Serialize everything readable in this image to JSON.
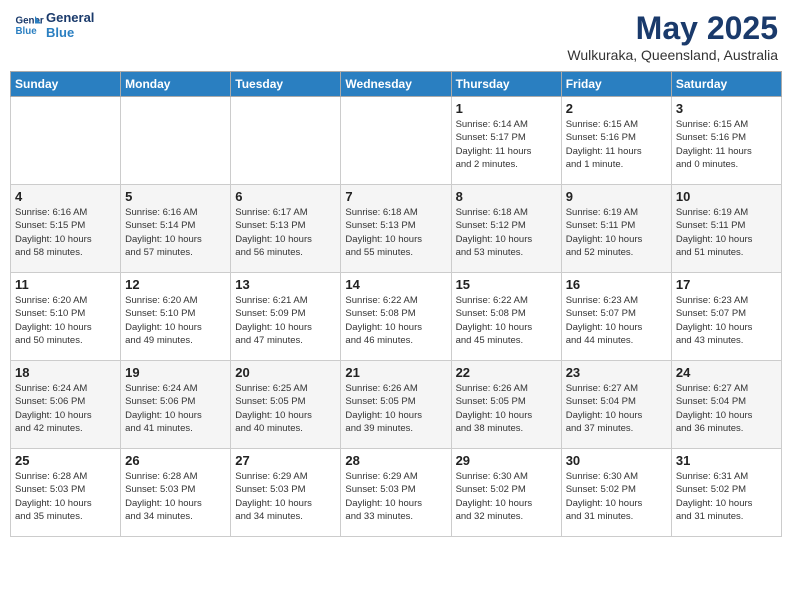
{
  "header": {
    "logo_line1": "General",
    "logo_line2": "Blue",
    "title": "May 2025",
    "subtitle": "Wulkuraka, Queensland, Australia"
  },
  "columns": [
    "Sunday",
    "Monday",
    "Tuesday",
    "Wednesday",
    "Thursday",
    "Friday",
    "Saturday"
  ],
  "weeks": [
    [
      {
        "day": "",
        "info": ""
      },
      {
        "day": "",
        "info": ""
      },
      {
        "day": "",
        "info": ""
      },
      {
        "day": "",
        "info": ""
      },
      {
        "day": "1",
        "info": "Sunrise: 6:14 AM\nSunset: 5:17 PM\nDaylight: 11 hours\nand 2 minutes."
      },
      {
        "day": "2",
        "info": "Sunrise: 6:15 AM\nSunset: 5:16 PM\nDaylight: 11 hours\nand 1 minute."
      },
      {
        "day": "3",
        "info": "Sunrise: 6:15 AM\nSunset: 5:16 PM\nDaylight: 11 hours\nand 0 minutes."
      }
    ],
    [
      {
        "day": "4",
        "info": "Sunrise: 6:16 AM\nSunset: 5:15 PM\nDaylight: 10 hours\nand 58 minutes."
      },
      {
        "day": "5",
        "info": "Sunrise: 6:16 AM\nSunset: 5:14 PM\nDaylight: 10 hours\nand 57 minutes."
      },
      {
        "day": "6",
        "info": "Sunrise: 6:17 AM\nSunset: 5:13 PM\nDaylight: 10 hours\nand 56 minutes."
      },
      {
        "day": "7",
        "info": "Sunrise: 6:18 AM\nSunset: 5:13 PM\nDaylight: 10 hours\nand 55 minutes."
      },
      {
        "day": "8",
        "info": "Sunrise: 6:18 AM\nSunset: 5:12 PM\nDaylight: 10 hours\nand 53 minutes."
      },
      {
        "day": "9",
        "info": "Sunrise: 6:19 AM\nSunset: 5:11 PM\nDaylight: 10 hours\nand 52 minutes."
      },
      {
        "day": "10",
        "info": "Sunrise: 6:19 AM\nSunset: 5:11 PM\nDaylight: 10 hours\nand 51 minutes."
      }
    ],
    [
      {
        "day": "11",
        "info": "Sunrise: 6:20 AM\nSunset: 5:10 PM\nDaylight: 10 hours\nand 50 minutes."
      },
      {
        "day": "12",
        "info": "Sunrise: 6:20 AM\nSunset: 5:10 PM\nDaylight: 10 hours\nand 49 minutes."
      },
      {
        "day": "13",
        "info": "Sunrise: 6:21 AM\nSunset: 5:09 PM\nDaylight: 10 hours\nand 47 minutes."
      },
      {
        "day": "14",
        "info": "Sunrise: 6:22 AM\nSunset: 5:08 PM\nDaylight: 10 hours\nand 46 minutes."
      },
      {
        "day": "15",
        "info": "Sunrise: 6:22 AM\nSunset: 5:08 PM\nDaylight: 10 hours\nand 45 minutes."
      },
      {
        "day": "16",
        "info": "Sunrise: 6:23 AM\nSunset: 5:07 PM\nDaylight: 10 hours\nand 44 minutes."
      },
      {
        "day": "17",
        "info": "Sunrise: 6:23 AM\nSunset: 5:07 PM\nDaylight: 10 hours\nand 43 minutes."
      }
    ],
    [
      {
        "day": "18",
        "info": "Sunrise: 6:24 AM\nSunset: 5:06 PM\nDaylight: 10 hours\nand 42 minutes."
      },
      {
        "day": "19",
        "info": "Sunrise: 6:24 AM\nSunset: 5:06 PM\nDaylight: 10 hours\nand 41 minutes."
      },
      {
        "day": "20",
        "info": "Sunrise: 6:25 AM\nSunset: 5:05 PM\nDaylight: 10 hours\nand 40 minutes."
      },
      {
        "day": "21",
        "info": "Sunrise: 6:26 AM\nSunset: 5:05 PM\nDaylight: 10 hours\nand 39 minutes."
      },
      {
        "day": "22",
        "info": "Sunrise: 6:26 AM\nSunset: 5:05 PM\nDaylight: 10 hours\nand 38 minutes."
      },
      {
        "day": "23",
        "info": "Sunrise: 6:27 AM\nSunset: 5:04 PM\nDaylight: 10 hours\nand 37 minutes."
      },
      {
        "day": "24",
        "info": "Sunrise: 6:27 AM\nSunset: 5:04 PM\nDaylight: 10 hours\nand 36 minutes."
      }
    ],
    [
      {
        "day": "25",
        "info": "Sunrise: 6:28 AM\nSunset: 5:03 PM\nDaylight: 10 hours\nand 35 minutes."
      },
      {
        "day": "26",
        "info": "Sunrise: 6:28 AM\nSunset: 5:03 PM\nDaylight: 10 hours\nand 34 minutes."
      },
      {
        "day": "27",
        "info": "Sunrise: 6:29 AM\nSunset: 5:03 PM\nDaylight: 10 hours\nand 34 minutes."
      },
      {
        "day": "28",
        "info": "Sunrise: 6:29 AM\nSunset: 5:03 PM\nDaylight: 10 hours\nand 33 minutes."
      },
      {
        "day": "29",
        "info": "Sunrise: 6:30 AM\nSunset: 5:02 PM\nDaylight: 10 hours\nand 32 minutes."
      },
      {
        "day": "30",
        "info": "Sunrise: 6:30 AM\nSunset: 5:02 PM\nDaylight: 10 hours\nand 31 minutes."
      },
      {
        "day": "31",
        "info": "Sunrise: 6:31 AM\nSunset: 5:02 PM\nDaylight: 10 hours\nand 31 minutes."
      }
    ]
  ]
}
